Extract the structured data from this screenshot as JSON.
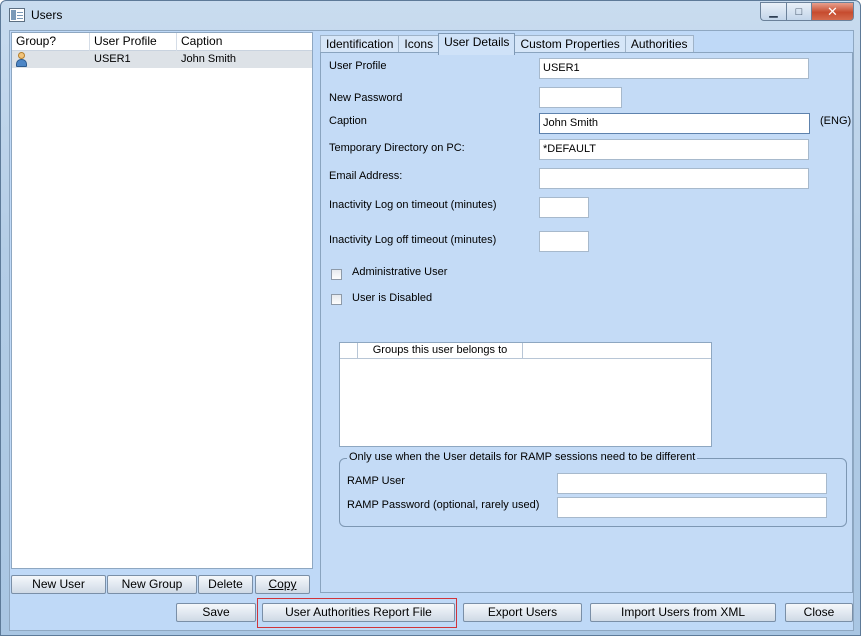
{
  "window": {
    "title": "Users"
  },
  "user_list": {
    "columns": [
      "Group?",
      "User Profile",
      "Caption"
    ],
    "rows": [
      {
        "profile": "USER1",
        "caption": "John Smith"
      }
    ]
  },
  "list_buttons": {
    "new_user": "New User",
    "new_group": "New Group",
    "delete": "Delete",
    "copy": "Copy"
  },
  "tabs": [
    "Identification",
    "Icons",
    "User Details",
    "Custom Properties",
    "Authorities"
  ],
  "details": {
    "user_profile_label": "User Profile",
    "user_profile_value": "USER1",
    "new_password_label": "New Password",
    "new_password_value": "",
    "caption_label": "Caption",
    "caption_value": "John Smith",
    "caption_lang": "(ENG)",
    "temp_dir_label": "Temporary Directory on PC:",
    "temp_dir_value": "*DEFAULT",
    "email_label": "Email Address:",
    "email_value": "",
    "logon_timeout_label": "Inactivity Log on timeout (minutes)",
    "logon_timeout_value": "",
    "logoff_timeout_label": "Inactivity Log off timeout (minutes)",
    "logoff_timeout_value": "",
    "admin_label": "Administrative User",
    "disabled_label": "User is Disabled",
    "groups_header": "Groups this user belongs to"
  },
  "ramp": {
    "legend": "Only use when the User details for RAMP sessions need to be different",
    "user_label": "RAMP User",
    "user_value": "",
    "password_label": "RAMP Password (optional, rarely used)",
    "password_value": ""
  },
  "bottom_buttons": {
    "save": "Save",
    "report": "User Authorities Report File",
    "export": "Export Users",
    "import": "Import Users from XML",
    "close": "Close"
  },
  "colors": {
    "client_bg": "#bfd9f7",
    "focus_outline": "#d0343a"
  }
}
